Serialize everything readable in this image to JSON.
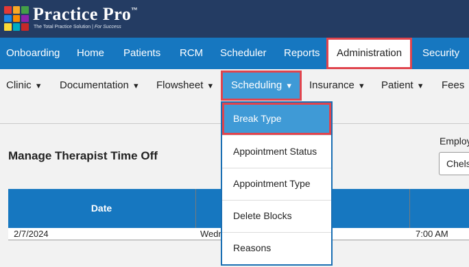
{
  "brand": {
    "title": "Practice Pro",
    "tm": "™",
    "subtitle_main": "The Total Practice Solution | ",
    "subtitle_em": "For Success",
    "logo_colors": [
      "#e53935",
      "#f9a825",
      "#43a047",
      "#1e88e5",
      "#fb8c00",
      "#8e24aa",
      "#fdd835",
      "#00acc1",
      "#c62828"
    ]
  },
  "topnav": {
    "items": [
      {
        "label": "Onboarding"
      },
      {
        "label": "Home"
      },
      {
        "label": "Patients"
      },
      {
        "label": "RCM"
      },
      {
        "label": "Scheduler"
      },
      {
        "label": "Reports"
      },
      {
        "label": "Administration"
      },
      {
        "label": "Security"
      }
    ],
    "active": "Administration"
  },
  "subnav": {
    "items": [
      {
        "label": "Clinic"
      },
      {
        "label": "Documentation"
      },
      {
        "label": "Flowsheet"
      },
      {
        "label": "Scheduling"
      },
      {
        "label": "Insurance"
      },
      {
        "label": "Patient"
      },
      {
        "label": "Fees"
      }
    ],
    "caret": "▼",
    "active": "Scheduling"
  },
  "dropdown": {
    "items": [
      {
        "label": "Break Type"
      },
      {
        "label": "Appointment Status"
      },
      {
        "label": "Appointment Type"
      },
      {
        "label": "Delete Blocks"
      },
      {
        "label": "Reasons"
      }
    ],
    "active": "Break Type"
  },
  "main": {
    "title": "Manage Therapist Time Off",
    "employee_label": "Employ",
    "employee_value": "Chels"
  },
  "table": {
    "headers": [
      "Date"
    ],
    "rows": [
      [
        "2/7/2024",
        "Wedn",
        "7:00 AM"
      ]
    ]
  },
  "colors": {
    "header_bg": "#243c63",
    "nav_bg": "#1677c0",
    "highlight": "#e0444d",
    "active_bg": "#3f9ad6"
  }
}
